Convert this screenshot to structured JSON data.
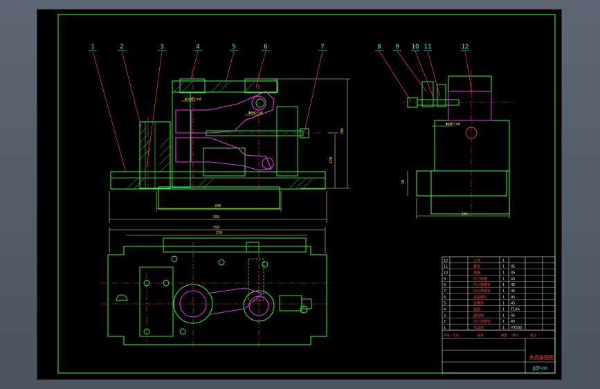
{
  "drawing": {
    "title": "夹具装配图",
    "drawing_code": "JJZP-00"
  },
  "balloons": [
    "1",
    "2",
    "3",
    "4",
    "5",
    "6",
    "7",
    "8",
    "9",
    "10",
    "11",
    "12"
  ],
  "table_rows": [
    {
      "no": "12",
      "code": "",
      "name": "工件",
      "qty": "1",
      "mat": "",
      "note": ""
    },
    {
      "no": "11",
      "code": "",
      "name": "螺母",
      "qty": "1",
      "mat": "45",
      "note": ""
    },
    {
      "no": "10",
      "code": "",
      "name": "垫圈",
      "qty": "1",
      "mat": "45",
      "note": ""
    },
    {
      "no": "9",
      "code": "",
      "name": "开口垫圈",
      "qty": "1",
      "mat": "45",
      "note": ""
    },
    {
      "no": "8",
      "code": "",
      "name": "内六角螺钉",
      "qty": "1",
      "mat": "45",
      "note": ""
    },
    {
      "no": "7",
      "code": "",
      "name": "内六角螺钉",
      "qty": "1",
      "mat": "45",
      "note": ""
    },
    {
      "no": "6",
      "code": "",
      "name": "夹紧螺钉",
      "qty": "1",
      "mat": "45",
      "note": ""
    },
    {
      "no": "5",
      "code": "",
      "name": "钻模板",
      "qty": "1",
      "mat": "45",
      "note": ""
    },
    {
      "no": "4",
      "code": "",
      "name": "钻套",
      "qty": "1",
      "mat": "T10A",
      "note": ""
    },
    {
      "no": "3",
      "code": "",
      "name": "圆柱销",
      "qty": "1",
      "mat": "45",
      "note": ""
    },
    {
      "no": "2",
      "code": "",
      "name": "内六角螺钉",
      "qty": "1",
      "mat": "45",
      "note": ""
    },
    {
      "no": "1",
      "code": "",
      "name": "夹具体",
      "qty": "1",
      "mat": "HT200",
      "note": ""
    }
  ],
  "colors": {
    "frame": "#22dd22",
    "outline": "#33ff33",
    "leader": "#ff4040",
    "dim": "#ffee22",
    "part": "#ee33ee",
    "label": "#33ffff",
    "cyan": "#22dddd",
    "white": "#e8e8e8"
  }
}
